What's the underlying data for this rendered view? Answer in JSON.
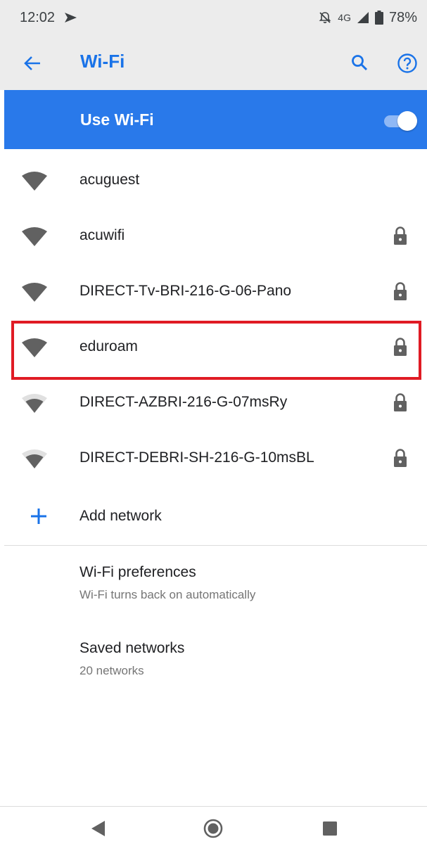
{
  "status_bar": {
    "time": "12:02",
    "network": "4G",
    "battery": "78%"
  },
  "toolbar": {
    "title": "Wi-Fi"
  },
  "use_wifi": {
    "label": "Use Wi-Fi",
    "enabled": true
  },
  "networks": [
    {
      "ssid": "acuguest",
      "locked": false,
      "signal": "strong"
    },
    {
      "ssid": "acuwifi",
      "locked": true,
      "signal": "strong"
    },
    {
      "ssid": "DIRECT-Tv-BRI-216-G-06-Pano",
      "locked": true,
      "signal": "strong"
    },
    {
      "ssid": "eduroam",
      "locked": true,
      "signal": "strong"
    },
    {
      "ssid": "DIRECT-AZBRI-216-G-07msRy",
      "locked": true,
      "signal": "medium"
    },
    {
      "ssid": "DIRECT-DEBRI-SH-216-G-10msBL",
      "locked": true,
      "signal": "medium"
    }
  ],
  "add_network": {
    "label": "Add network"
  },
  "preferences": {
    "title": "Wi-Fi preferences",
    "subtitle": "Wi-Fi turns back on automatically"
  },
  "saved_networks": {
    "title": "Saved networks",
    "subtitle": "20 networks"
  },
  "colors": {
    "accent": "#1a73e8",
    "banner": "#2979ea",
    "highlight": "#e01b24"
  }
}
